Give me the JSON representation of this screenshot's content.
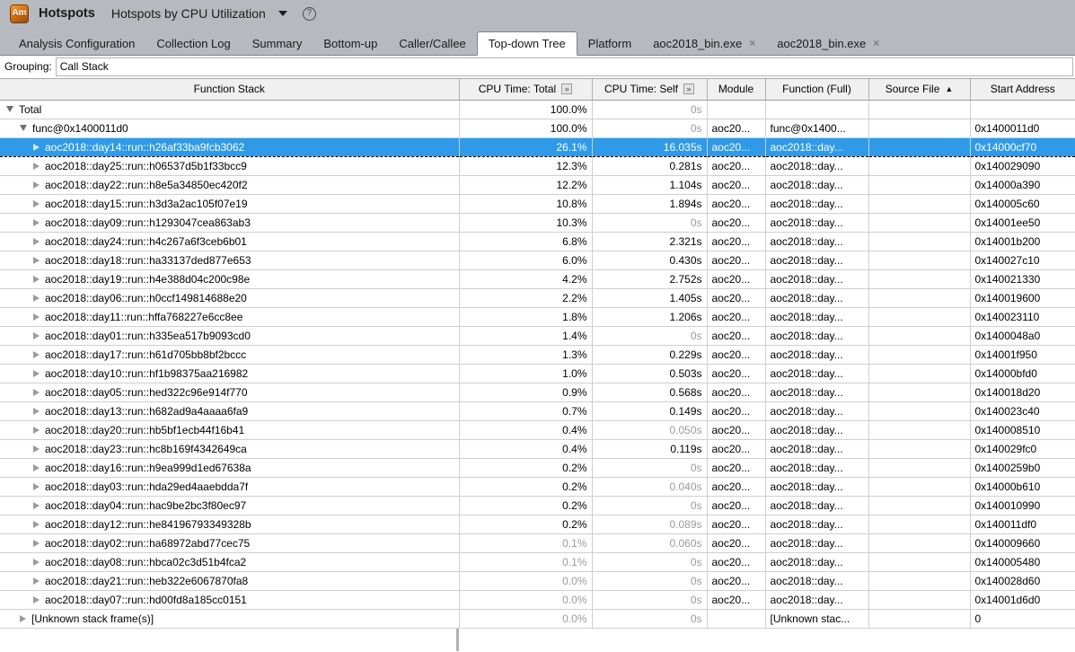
{
  "header": {
    "logo_text": "Am",
    "app_title": "Hotspots",
    "analysis_name": "Hotspots by CPU Utilization",
    "dropdown_icon": "chevron-down-icon",
    "help_icon": "question-mark-icon"
  },
  "tabs": [
    {
      "label": "Analysis Configuration",
      "active": false,
      "closable": false
    },
    {
      "label": "Collection Log",
      "active": false,
      "closable": false
    },
    {
      "label": "Summary",
      "active": false,
      "closable": false
    },
    {
      "label": "Bottom-up",
      "active": false,
      "closable": false
    },
    {
      "label": "Caller/Callee",
      "active": false,
      "closable": false
    },
    {
      "label": "Top-down Tree",
      "active": true,
      "closable": false
    },
    {
      "label": "Platform",
      "active": false,
      "closable": false
    },
    {
      "label": "aoc2018_bin.exe",
      "active": false,
      "closable": true,
      "close_label": "×"
    },
    {
      "label": "aoc2018_bin.exe",
      "active": false,
      "closable": true,
      "close_label": "×"
    }
  ],
  "grouping": {
    "label": "Grouping:",
    "value": "Call Stack"
  },
  "table": {
    "columns": [
      {
        "key": "fnstack",
        "label": "Function Stack",
        "expander": null,
        "sorted": null
      },
      {
        "key": "total",
        "label": "CPU Time: Total",
        "expander": "»",
        "sorted": null
      },
      {
        "key": "self",
        "label": "CPU Time: Self",
        "expander": "»",
        "sorted": null
      },
      {
        "key": "module",
        "label": "Module",
        "expander": null,
        "sorted": null
      },
      {
        "key": "func",
        "label": "Function (Full)",
        "expander": null,
        "sorted": null
      },
      {
        "key": "src",
        "label": "Source File",
        "expander": null,
        "sorted": "▲"
      },
      {
        "key": "addr",
        "label": "Start Address",
        "expander": null,
        "sorted": null
      }
    ],
    "rows": [
      {
        "fnstack": "Total",
        "level": 0,
        "tri": "expanded",
        "total": "100.0%",
        "self": "0s",
        "self_zero": true,
        "module": "",
        "func": "",
        "src": "",
        "addr": "",
        "selected": false,
        "dim": false
      },
      {
        "fnstack": "func@0x1400011d0",
        "level": 1,
        "tri": "expanded",
        "total": "100.0%",
        "self": "0s",
        "self_zero": true,
        "module": "aoc20...",
        "func": "func@0x1400...",
        "src": "",
        "addr": "0x1400011d0",
        "selected": false,
        "dim": false
      },
      {
        "fnstack": "aoc2018::day14::run::h26af33ba9fcb3062",
        "level": 2,
        "tri": "collapsed",
        "total": "26.1%",
        "self": "16.035s",
        "self_zero": false,
        "module": "aoc20...",
        "func": "aoc2018::day...",
        "src": "",
        "addr": "0x14000cf70",
        "selected": true,
        "dim": false
      },
      {
        "fnstack": "aoc2018::day25::run::h06537d5b1f33bcc9",
        "level": 2,
        "tri": "collapsed",
        "total": "12.3%",
        "self": "0.281s",
        "self_zero": false,
        "module": "aoc20...",
        "func": "aoc2018::day...",
        "src": "",
        "addr": "0x140029090",
        "selected": false,
        "dim": false
      },
      {
        "fnstack": "aoc2018::day22::run::h8e5a34850ec420f2",
        "level": 2,
        "tri": "collapsed",
        "total": "12.2%",
        "self": "1.104s",
        "self_zero": false,
        "module": "aoc20...",
        "func": "aoc2018::day...",
        "src": "",
        "addr": "0x14000a390",
        "selected": false,
        "dim": false
      },
      {
        "fnstack": "aoc2018::day15::run::h3d3a2ac105f07e19",
        "level": 2,
        "tri": "collapsed",
        "total": "10.8%",
        "self": "1.894s",
        "self_zero": false,
        "module": "aoc20...",
        "func": "aoc2018::day...",
        "src": "",
        "addr": "0x140005c60",
        "selected": false,
        "dim": false
      },
      {
        "fnstack": "aoc2018::day09::run::h1293047cea863ab3",
        "level": 2,
        "tri": "collapsed",
        "total": "10.3%",
        "self": "0s",
        "self_zero": true,
        "module": "aoc20...",
        "func": "aoc2018::day...",
        "src": "",
        "addr": "0x14001ee50",
        "selected": false,
        "dim": false
      },
      {
        "fnstack": "aoc2018::day24::run::h4c267a6f3ceb6b01",
        "level": 2,
        "tri": "collapsed",
        "total": "6.8%",
        "self": "2.321s",
        "self_zero": false,
        "module": "aoc20...",
        "func": "aoc2018::day...",
        "src": "",
        "addr": "0x14001b200",
        "selected": false,
        "dim": false
      },
      {
        "fnstack": "aoc2018::day18::run::ha33137ded877e653",
        "level": 2,
        "tri": "collapsed",
        "total": "6.0%",
        "self": "0.430s",
        "self_zero": false,
        "module": "aoc20...",
        "func": "aoc2018::day...",
        "src": "",
        "addr": "0x140027c10",
        "selected": false,
        "dim": false
      },
      {
        "fnstack": "aoc2018::day19::run::h4e388d04c200c98e",
        "level": 2,
        "tri": "collapsed",
        "total": "4.2%",
        "self": "2.752s",
        "self_zero": false,
        "module": "aoc20...",
        "func": "aoc2018::day...",
        "src": "",
        "addr": "0x140021330",
        "selected": false,
        "dim": false
      },
      {
        "fnstack": "aoc2018::day06::run::h0ccf149814688e20",
        "level": 2,
        "tri": "collapsed",
        "total": "2.2%",
        "self": "1.405s",
        "self_zero": false,
        "module": "aoc20...",
        "func": "aoc2018::day...",
        "src": "",
        "addr": "0x140019600",
        "selected": false,
        "dim": false
      },
      {
        "fnstack": "aoc2018::day11::run::hffa768227e6cc8ee",
        "level": 2,
        "tri": "collapsed",
        "total": "1.8%",
        "self": "1.206s",
        "self_zero": false,
        "module": "aoc20...",
        "func": "aoc2018::day...",
        "src": "",
        "addr": "0x140023110",
        "selected": false,
        "dim": false
      },
      {
        "fnstack": "aoc2018::day01::run::h335ea517b9093cd0",
        "level": 2,
        "tri": "collapsed",
        "total": "1.4%",
        "self": "0s",
        "self_zero": true,
        "module": "aoc20...",
        "func": "aoc2018::day...",
        "src": "",
        "addr": "0x1400048a0",
        "selected": false,
        "dim": false
      },
      {
        "fnstack": "aoc2018::day17::run::h61d705bb8bf2bccc",
        "level": 2,
        "tri": "collapsed",
        "total": "1.3%",
        "self": "0.229s",
        "self_zero": false,
        "module": "aoc20...",
        "func": "aoc2018::day...",
        "src": "",
        "addr": "0x14001f950",
        "selected": false,
        "dim": false
      },
      {
        "fnstack": "aoc2018::day10::run::hf1b98375aa216982",
        "level": 2,
        "tri": "collapsed",
        "total": "1.0%",
        "self": "0.503s",
        "self_zero": false,
        "module": "aoc20...",
        "func": "aoc2018::day...",
        "src": "",
        "addr": "0x14000bfd0",
        "selected": false,
        "dim": false
      },
      {
        "fnstack": "aoc2018::day05::run::hed322c96e914f770",
        "level": 2,
        "tri": "collapsed",
        "total": "0.9%",
        "self": "0.568s",
        "self_zero": false,
        "module": "aoc20...",
        "func": "aoc2018::day...",
        "src": "",
        "addr": "0x140018d20",
        "selected": false,
        "dim": false
      },
      {
        "fnstack": "aoc2018::day13::run::h682ad9a4aaaa6fa9",
        "level": 2,
        "tri": "collapsed",
        "total": "0.7%",
        "self": "0.149s",
        "self_zero": false,
        "module": "aoc20...",
        "func": "aoc2018::day...",
        "src": "",
        "addr": "0x140023c40",
        "selected": false,
        "dim": false
      },
      {
        "fnstack": "aoc2018::day20::run::hb5bf1ecb44f16b41",
        "level": 2,
        "tri": "collapsed",
        "total": "0.4%",
        "self": "0.050s",
        "self_zero": true,
        "module": "aoc20...",
        "func": "aoc2018::day...",
        "src": "",
        "addr": "0x140008510",
        "selected": false,
        "dim": false
      },
      {
        "fnstack": "aoc2018::day23::run::hc8b169f4342649ca",
        "level": 2,
        "tri": "collapsed",
        "total": "0.4%",
        "self": "0.119s",
        "self_zero": false,
        "module": "aoc20...",
        "func": "aoc2018::day...",
        "src": "",
        "addr": "0x140029fc0",
        "selected": false,
        "dim": false
      },
      {
        "fnstack": "aoc2018::day16::run::h9ea999d1ed67638a",
        "level": 2,
        "tri": "collapsed",
        "total": "0.2%",
        "self": "0s",
        "self_zero": true,
        "module": "aoc20...",
        "func": "aoc2018::day...",
        "src": "",
        "addr": "0x1400259b0",
        "selected": false,
        "dim": false
      },
      {
        "fnstack": "aoc2018::day03::run::hda29ed4aaebdda7f",
        "level": 2,
        "tri": "collapsed",
        "total": "0.2%",
        "self": "0.040s",
        "self_zero": true,
        "module": "aoc20...",
        "func": "aoc2018::day...",
        "src": "",
        "addr": "0x14000b610",
        "selected": false,
        "dim": false
      },
      {
        "fnstack": "aoc2018::day04::run::hac9be2bc3f80ec97",
        "level": 2,
        "tri": "collapsed",
        "total": "0.2%",
        "self": "0s",
        "self_zero": true,
        "module": "aoc20...",
        "func": "aoc2018::day...",
        "src": "",
        "addr": "0x140010990",
        "selected": false,
        "dim": false
      },
      {
        "fnstack": "aoc2018::day12::run::he84196793349328b",
        "level": 2,
        "tri": "collapsed",
        "total": "0.2%",
        "self": "0.089s",
        "self_zero": true,
        "module": "aoc20...",
        "func": "aoc2018::day...",
        "src": "",
        "addr": "0x140011df0",
        "selected": false,
        "dim": false
      },
      {
        "fnstack": "aoc2018::day02::run::ha68972abd77cec75",
        "level": 2,
        "tri": "collapsed",
        "total": "0.1%",
        "self": "0.060s",
        "self_zero": true,
        "module": "aoc20...",
        "func": "aoc2018::day...",
        "src": "",
        "addr": "0x140009660",
        "selected": false,
        "dim": true
      },
      {
        "fnstack": "aoc2018::day08::run::hbca02c3d51b4fca2",
        "level": 2,
        "tri": "collapsed",
        "total": "0.1%",
        "self": "0s",
        "self_zero": true,
        "module": "aoc20...",
        "func": "aoc2018::day...",
        "src": "",
        "addr": "0x140005480",
        "selected": false,
        "dim": true
      },
      {
        "fnstack": "aoc2018::day21::run::heb322e6067870fa8",
        "level": 2,
        "tri": "collapsed",
        "total": "0.0%",
        "self": "0s",
        "self_zero": true,
        "module": "aoc20...",
        "func": "aoc2018::day...",
        "src": "",
        "addr": "0x140028d60",
        "selected": false,
        "dim": true
      },
      {
        "fnstack": "aoc2018::day07::run::hd00fd8a185cc0151",
        "level": 2,
        "tri": "collapsed",
        "total": "0.0%",
        "self": "0s",
        "self_zero": true,
        "module": "aoc20...",
        "func": "aoc2018::day...",
        "src": "",
        "addr": "0x14001d6d0",
        "selected": false,
        "dim": true
      },
      {
        "fnstack": "[Unknown stack frame(s)]",
        "level": 1,
        "tri": "collapsed",
        "total": "0.0%",
        "self": "0s",
        "self_zero": true,
        "module": "",
        "func": "[Unknown stac...",
        "src": "",
        "addr": "0",
        "selected": false,
        "dim": true
      }
    ]
  }
}
